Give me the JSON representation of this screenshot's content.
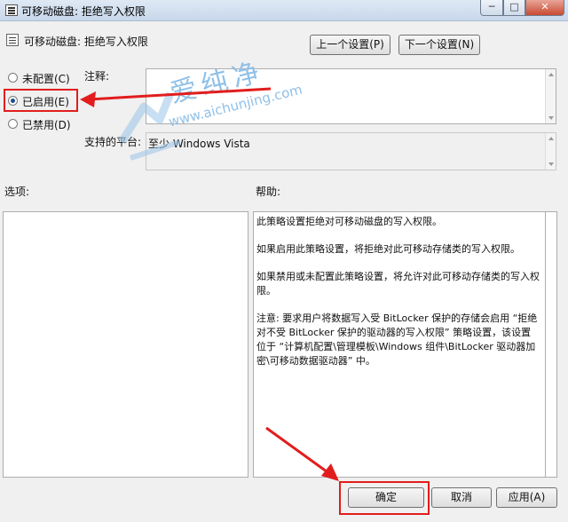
{
  "window": {
    "title": "可移动磁盘: 拒绝写入权限",
    "buttons": {
      "minimize": "─",
      "maximize": "□",
      "close": "✕"
    }
  },
  "header": {
    "policy_title": "可移动磁盘: 拒绝写入权限",
    "prev_button": "上一个设置(P)",
    "next_button": "下一个设置(N)"
  },
  "state_options": [
    {
      "label": "未配置(C)",
      "checked": false
    },
    {
      "label": "已启用(E)",
      "checked": true
    },
    {
      "label": "已禁用(D)",
      "checked": false
    }
  ],
  "fields": {
    "comment_label": "注释:",
    "comment_value": "",
    "platform_label": "支持的平台:",
    "platform_value": "至少 Windows Vista"
  },
  "sections": {
    "options_label": "选项:",
    "help_label": "帮助:"
  },
  "help_paragraphs": [
    "此策略设置拒绝对可移动磁盘的写入权限。",
    "如果启用此策略设置，将拒绝对此可移动存储类的写入权限。",
    "如果禁用或未配置此策略设置，将允许对此可移动存储类的写入权限。",
    "注意: 要求用户将数据写入受 BitLocker 保护的存储会启用 “拒绝对不受 BitLocker 保护的驱动器的写入权限” 策略设置，该设置位于 “计算机配置\\管理模板\\Windows 组件\\BitLocker 驱动器加密\\可移动数据驱动器” 中。"
  ],
  "footer": {
    "ok_button": "确定",
    "cancel_button": "取消",
    "apply_button": "应用(A)"
  },
  "watermark": {
    "text": "爱纯净",
    "url": "www.aichunjing.com"
  },
  "colors": {
    "highlight": "#e21d1d",
    "title_bar": "#c7d7ea",
    "close_button": "#c94a32"
  },
  "icons": {
    "app": "policy-document-icon",
    "policy": "policy-document-icon"
  }
}
